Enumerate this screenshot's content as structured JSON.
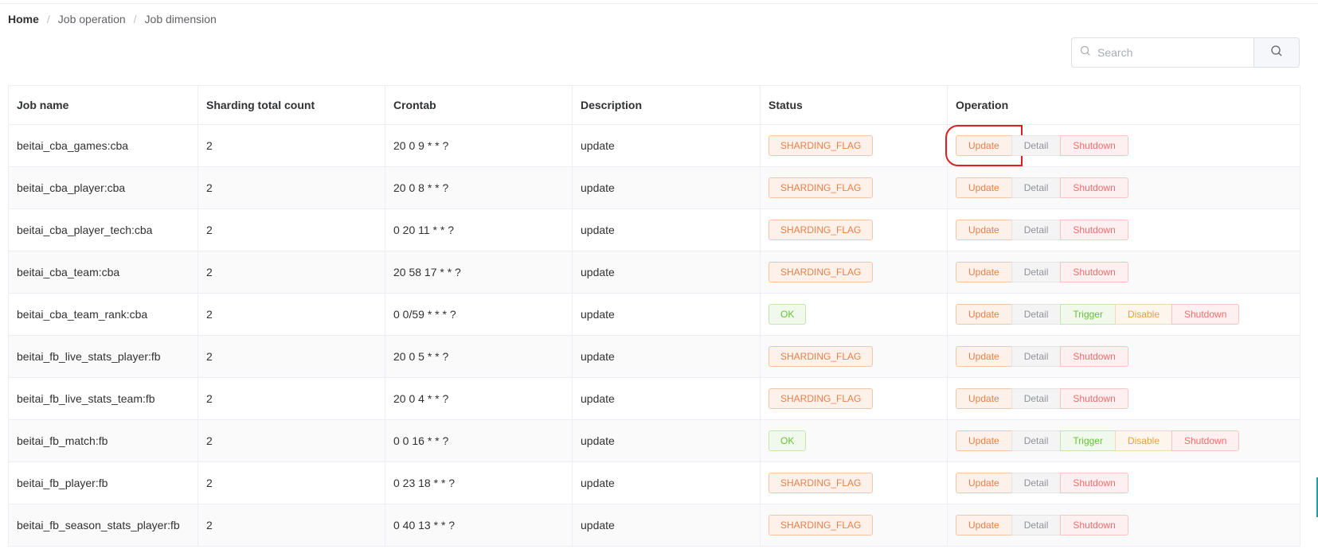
{
  "breadcrumb": {
    "home": "Home",
    "items": [
      "Job operation",
      "Job dimension"
    ],
    "separator": "/"
  },
  "search": {
    "placeholder": "Search",
    "value": ""
  },
  "table": {
    "columns": [
      "Job name",
      "Sharding total count",
      "Crontab",
      "Description",
      "Status",
      "Operation"
    ],
    "rows": [
      {
        "job_name": "beitai_cba_games:cba",
        "sharding_total_count": "2",
        "crontab": "20 0 9 * * ?",
        "description": "update",
        "status": "SHARDING_FLAG",
        "operations": [
          "Update",
          "Detail",
          "Shutdown"
        ]
      },
      {
        "job_name": "beitai_cba_player:cba",
        "sharding_total_count": "2",
        "crontab": "20 0 8 * * ?",
        "description": "update",
        "status": "SHARDING_FLAG",
        "operations": [
          "Update",
          "Detail",
          "Shutdown"
        ]
      },
      {
        "job_name": "beitai_cba_player_tech:cba",
        "sharding_total_count": "2",
        "crontab": "0 20 11 * * ?",
        "description": "update",
        "status": "SHARDING_FLAG",
        "operations": [
          "Update",
          "Detail",
          "Shutdown"
        ]
      },
      {
        "job_name": "beitai_cba_team:cba",
        "sharding_total_count": "2",
        "crontab": "20 58 17 * * ?",
        "description": "update",
        "status": "SHARDING_FLAG",
        "operations": [
          "Update",
          "Detail",
          "Shutdown"
        ]
      },
      {
        "job_name": "beitai_cba_team_rank:cba",
        "sharding_total_count": "2",
        "crontab": "0 0/59 * * * ?",
        "description": "update",
        "status": "OK",
        "operations": [
          "Update",
          "Detail",
          "Trigger",
          "Disable",
          "Shutdown"
        ]
      },
      {
        "job_name": "beitai_fb_live_stats_player:fb",
        "sharding_total_count": "2",
        "crontab": "20 0 5 * * ?",
        "description": "update",
        "status": "SHARDING_FLAG",
        "operations": [
          "Update",
          "Detail",
          "Shutdown"
        ]
      },
      {
        "job_name": "beitai_fb_live_stats_team:fb",
        "sharding_total_count": "2",
        "crontab": "20 0 4 * * ?",
        "description": "update",
        "status": "SHARDING_FLAG",
        "operations": [
          "Update",
          "Detail",
          "Shutdown"
        ]
      },
      {
        "job_name": "beitai_fb_match:fb",
        "sharding_total_count": "2",
        "crontab": "0 0 16 * * ?",
        "description": "update",
        "status": "OK",
        "operations": [
          "Update",
          "Detail",
          "Trigger",
          "Disable",
          "Shutdown"
        ]
      },
      {
        "job_name": "beitai_fb_player:fb",
        "sharding_total_count": "2",
        "crontab": "0 23 18 * * ?",
        "description": "update",
        "status": "SHARDING_FLAG",
        "operations": [
          "Update",
          "Detail",
          "Shutdown"
        ]
      },
      {
        "job_name": "beitai_fb_season_stats_player:fb",
        "sharding_total_count": "2",
        "crontab": "0 40 13 * * ?",
        "description": "update",
        "status": "SHARDING_FLAG",
        "operations": [
          "Update",
          "Detail",
          "Shutdown"
        ]
      }
    ]
  },
  "icons": {
    "search_prefix": "search-icon",
    "search_button": "search-icon"
  },
  "colors": {
    "sharding_flag": "#e6814b",
    "ok": "#67c23a",
    "update": "#e6814b",
    "detail": "#909399",
    "trigger": "#67c23a",
    "disable": "#e6a23c",
    "shutdown": "#f56c6c",
    "highlight_box": "#e02020"
  }
}
